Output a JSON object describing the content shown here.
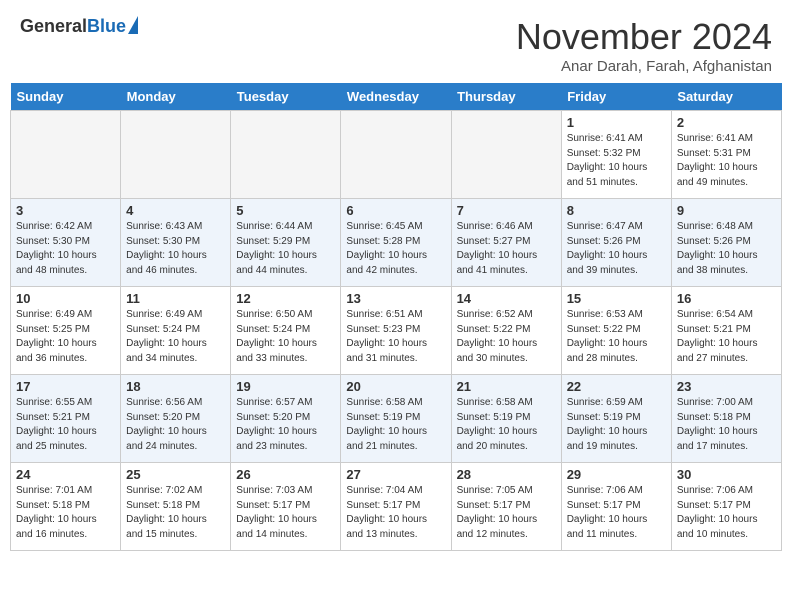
{
  "header": {
    "logo_general": "General",
    "logo_blue": "Blue",
    "month_title": "November 2024",
    "subtitle": "Anar Darah, Farah, Afghanistan"
  },
  "weekdays": [
    "Sunday",
    "Monday",
    "Tuesday",
    "Wednesday",
    "Thursday",
    "Friday",
    "Saturday"
  ],
  "weeks": [
    [
      {
        "day": "",
        "detail": ""
      },
      {
        "day": "",
        "detail": ""
      },
      {
        "day": "",
        "detail": ""
      },
      {
        "day": "",
        "detail": ""
      },
      {
        "day": "",
        "detail": ""
      },
      {
        "day": "1",
        "detail": "Sunrise: 6:41 AM\nSunset: 5:32 PM\nDaylight: 10 hours\nand 51 minutes."
      },
      {
        "day": "2",
        "detail": "Sunrise: 6:41 AM\nSunset: 5:31 PM\nDaylight: 10 hours\nand 49 minutes."
      }
    ],
    [
      {
        "day": "3",
        "detail": "Sunrise: 6:42 AM\nSunset: 5:30 PM\nDaylight: 10 hours\nand 48 minutes."
      },
      {
        "day": "4",
        "detail": "Sunrise: 6:43 AM\nSunset: 5:30 PM\nDaylight: 10 hours\nand 46 minutes."
      },
      {
        "day": "5",
        "detail": "Sunrise: 6:44 AM\nSunset: 5:29 PM\nDaylight: 10 hours\nand 44 minutes."
      },
      {
        "day": "6",
        "detail": "Sunrise: 6:45 AM\nSunset: 5:28 PM\nDaylight: 10 hours\nand 42 minutes."
      },
      {
        "day": "7",
        "detail": "Sunrise: 6:46 AM\nSunset: 5:27 PM\nDaylight: 10 hours\nand 41 minutes."
      },
      {
        "day": "8",
        "detail": "Sunrise: 6:47 AM\nSunset: 5:26 PM\nDaylight: 10 hours\nand 39 minutes."
      },
      {
        "day": "9",
        "detail": "Sunrise: 6:48 AM\nSunset: 5:26 PM\nDaylight: 10 hours\nand 38 minutes."
      }
    ],
    [
      {
        "day": "10",
        "detail": "Sunrise: 6:49 AM\nSunset: 5:25 PM\nDaylight: 10 hours\nand 36 minutes."
      },
      {
        "day": "11",
        "detail": "Sunrise: 6:49 AM\nSunset: 5:24 PM\nDaylight: 10 hours\nand 34 minutes."
      },
      {
        "day": "12",
        "detail": "Sunrise: 6:50 AM\nSunset: 5:24 PM\nDaylight: 10 hours\nand 33 minutes."
      },
      {
        "day": "13",
        "detail": "Sunrise: 6:51 AM\nSunset: 5:23 PM\nDaylight: 10 hours\nand 31 minutes."
      },
      {
        "day": "14",
        "detail": "Sunrise: 6:52 AM\nSunset: 5:22 PM\nDaylight: 10 hours\nand 30 minutes."
      },
      {
        "day": "15",
        "detail": "Sunrise: 6:53 AM\nSunset: 5:22 PM\nDaylight: 10 hours\nand 28 minutes."
      },
      {
        "day": "16",
        "detail": "Sunrise: 6:54 AM\nSunset: 5:21 PM\nDaylight: 10 hours\nand 27 minutes."
      }
    ],
    [
      {
        "day": "17",
        "detail": "Sunrise: 6:55 AM\nSunset: 5:21 PM\nDaylight: 10 hours\nand 25 minutes."
      },
      {
        "day": "18",
        "detail": "Sunrise: 6:56 AM\nSunset: 5:20 PM\nDaylight: 10 hours\nand 24 minutes."
      },
      {
        "day": "19",
        "detail": "Sunrise: 6:57 AM\nSunset: 5:20 PM\nDaylight: 10 hours\nand 23 minutes."
      },
      {
        "day": "20",
        "detail": "Sunrise: 6:58 AM\nSunset: 5:19 PM\nDaylight: 10 hours\nand 21 minutes."
      },
      {
        "day": "21",
        "detail": "Sunrise: 6:58 AM\nSunset: 5:19 PM\nDaylight: 10 hours\nand 20 minutes."
      },
      {
        "day": "22",
        "detail": "Sunrise: 6:59 AM\nSunset: 5:19 PM\nDaylight: 10 hours\nand 19 minutes."
      },
      {
        "day": "23",
        "detail": "Sunrise: 7:00 AM\nSunset: 5:18 PM\nDaylight: 10 hours\nand 17 minutes."
      }
    ],
    [
      {
        "day": "24",
        "detail": "Sunrise: 7:01 AM\nSunset: 5:18 PM\nDaylight: 10 hours\nand 16 minutes."
      },
      {
        "day": "25",
        "detail": "Sunrise: 7:02 AM\nSunset: 5:18 PM\nDaylight: 10 hours\nand 15 minutes."
      },
      {
        "day": "26",
        "detail": "Sunrise: 7:03 AM\nSunset: 5:17 PM\nDaylight: 10 hours\nand 14 minutes."
      },
      {
        "day": "27",
        "detail": "Sunrise: 7:04 AM\nSunset: 5:17 PM\nDaylight: 10 hours\nand 13 minutes."
      },
      {
        "day": "28",
        "detail": "Sunrise: 7:05 AM\nSunset: 5:17 PM\nDaylight: 10 hours\nand 12 minutes."
      },
      {
        "day": "29",
        "detail": "Sunrise: 7:06 AM\nSunset: 5:17 PM\nDaylight: 10 hours\nand 11 minutes."
      },
      {
        "day": "30",
        "detail": "Sunrise: 7:06 AM\nSunset: 5:17 PM\nDaylight: 10 hours\nand 10 minutes."
      }
    ]
  ]
}
